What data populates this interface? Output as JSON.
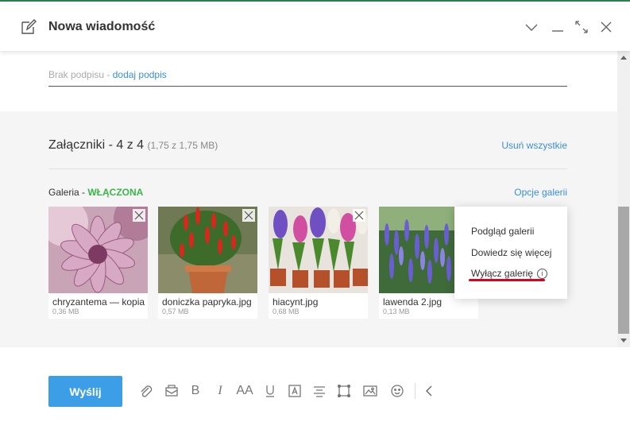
{
  "header": {
    "title": "Nowa wiadomość"
  },
  "signature": {
    "none_text": "Brak podpisu - ",
    "add_link": "dodaj podpis"
  },
  "attachments": {
    "title": "Załączniki - 4 z 4",
    "size_info": "(1,75 z 1,75 MB)",
    "remove_all": "Usuń wszystkie",
    "gallery_label": "Galeria - ",
    "gallery_status": "WŁĄCZONA",
    "gallery_options": "Opcje galerii",
    "files": [
      {
        "name": "chryzantema — kopia.jpg",
        "size": "0,36 MB"
      },
      {
        "name": "doniczka papryka.jpg",
        "size": "0,57 MB"
      },
      {
        "name": "hiacynt.jpg",
        "size": "0,68 MB"
      },
      {
        "name": "lawenda 2.jpg",
        "size": "0,13 MB"
      }
    ]
  },
  "gallery_menu": {
    "items": [
      "Podgląd galerii",
      "Dowiedz się więcej",
      "Wyłącz galerię"
    ]
  },
  "footer": {
    "send_label": "Wyślij",
    "font_size_glyph": "AA"
  },
  "colors": {
    "accent": "#3d9ee8",
    "link": "#3b8fd9",
    "gallery_on": "#3bb54a",
    "highlight": "#e0001a"
  }
}
